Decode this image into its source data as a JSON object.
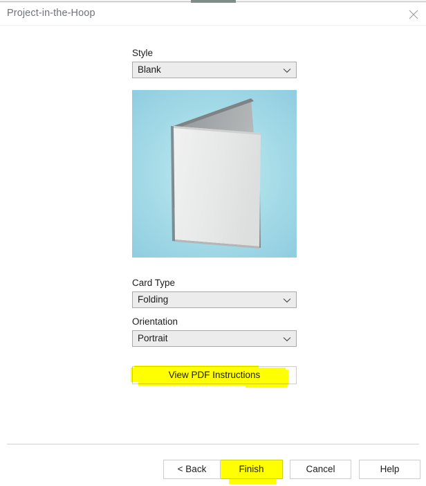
{
  "window": {
    "title": "Project-in-the-Hoop",
    "close_icon": "close-icon"
  },
  "form": {
    "style": {
      "label": "Style",
      "value": "Blank",
      "chevron_icon": "chevron-down-icon"
    },
    "card_type": {
      "label": "Card Type",
      "value": "Folding",
      "chevron_icon": "chevron-down-icon"
    },
    "orientation": {
      "label": "Orientation",
      "value": "Portrait",
      "chevron_icon": "chevron-down-icon"
    },
    "pdf_button": {
      "label": "View PDF Instructions"
    }
  },
  "preview": {
    "alt": "folding-card-preview",
    "background_color_outer": "#8ccbe0",
    "background_color_inner": "#c3eaf0",
    "card_front_color": "#e9eaea",
    "card_back_color": "#9fa2a4"
  },
  "annotations": {
    "highlight_color": "#ffff00",
    "highlighted_items": [
      "View PDF Instructions",
      "Finish"
    ]
  },
  "footer": {
    "buttons": [
      {
        "label": "< Back",
        "name": "back-button"
      },
      {
        "label": "Finish",
        "name": "finish-button"
      },
      {
        "label": "Cancel",
        "name": "cancel-button"
      },
      {
        "label": "Help",
        "name": "help-button"
      }
    ]
  }
}
